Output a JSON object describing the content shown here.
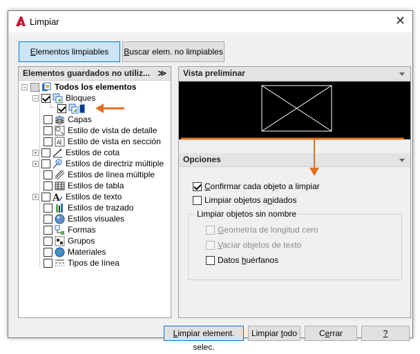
{
  "window": {
    "title": "Limpiar",
    "close_glyph": "✕",
    "app_icon": "autocad-a-icon"
  },
  "tabs": [
    {
      "u": "E",
      "rest": "lementos limpiables",
      "active": true
    },
    {
      "u": "B",
      "rest": "uscar elem. no limpiables",
      "active": false
    }
  ],
  "left_panel": {
    "header": "Elementos guardados no utiliz...",
    "chevron": "≫"
  },
  "tree": {
    "root": "Todos los elementos",
    "bloques": "Bloques",
    "items": [
      "Capas",
      "Estilo de vista de detalle",
      "Estilo de vista en sección",
      "Estilos de cota",
      "Estilos de directriz múltiple",
      "Estilos de línea múltiple",
      "Estilos de tabla",
      "Estilos de texto",
      "Estilos de trazado",
      "Estilos visuales",
      "Formas",
      "Grupos",
      "Materiales",
      "Tipos de línea"
    ]
  },
  "right_panel": {
    "preview_header": "Vista preliminar",
    "options_header": "Opciones",
    "confirm": {
      "u": "C",
      "rest": "onfirmar cada objeto a limpiar",
      "checked": true
    },
    "nested": {
      "pre": "Limpiar objetos a",
      "u": "n",
      "rest": "idados",
      "checked": false
    },
    "group_title": "Limpiar objetos sin nombre",
    "zero_geom": {
      "u": "G",
      "rest": "eometría de longitud cero"
    },
    "empty_text": {
      "u": "V",
      "rest": "aciar objetos de texto"
    },
    "orphan": {
      "pre": "Datos ",
      "u": "h",
      "rest": "uérfanos"
    }
  },
  "buttons": {
    "purge_selected": {
      "u": "L",
      "rest": "impiar element. selec."
    },
    "purge_all": {
      "pre": "Limpiar ",
      "u": "t",
      "rest": "odo"
    },
    "close": {
      "pre": "C",
      "u": "e",
      "rest": "rrar"
    },
    "help": {
      "u": "?"
    }
  },
  "colors": {
    "accent": "#0078d7",
    "annotation": "#e36f1e",
    "title_icon": "#c8102e"
  }
}
